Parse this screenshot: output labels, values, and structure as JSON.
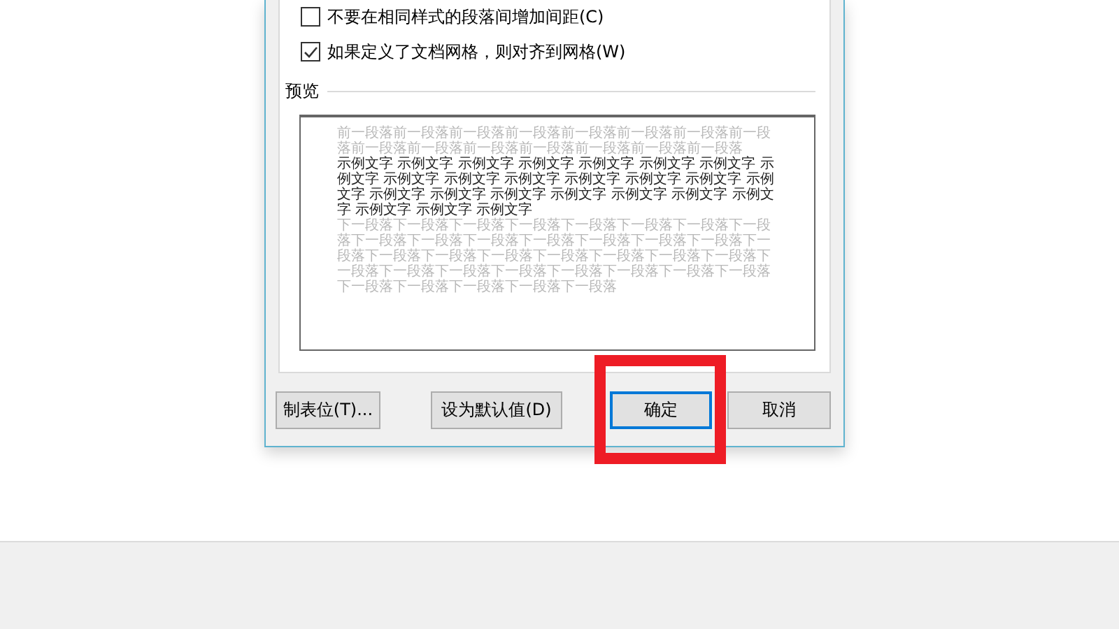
{
  "dialog": {
    "options": [
      {
        "label": "不要在相同样式的段落间增加间距(C)",
        "checked": false
      },
      {
        "label": "如果定义了文档网格，则对齐到网格(W)",
        "checked": true
      }
    ],
    "preview": {
      "label": "预览",
      "previous": "前一段落前一段落前一段落前一段落前一段落前一段落前一段落前一段落前一段落前一段落前一段落前一段落前一段落前一段落前一段落",
      "sample": "示例文字 示例文字 示例文字 示例文字 示例文字 示例文字 示例文字 示例文字 示例文字 示例文字 示例文字 示例文字 示例文字 示例文字 示例文字 示例文字 示例文字 示例文字 示例文字 示例文字 示例文字 示例文字 示例文字 示例文字 示例文字",
      "next": "下一段落下一段落下一段落下一段落下一段落下一段落下一段落下一段落下一段落下一段落下一段落下一段落下一段落下一段落下一段落下一段落下一段落下一段落下一段落下一段落下一段落下一段落下一段落下一段落下一段落下一段落下一段落下一段落下一段落下一段落下一段落下一段落下一段落下一段落下一段落下一段落"
    },
    "buttons": [
      {
        "label": "制表位(T)...",
        "default": false,
        "highlighted": false
      },
      {
        "label": "设为默认值(D)",
        "default": false,
        "highlighted": false
      },
      {
        "label": "确定",
        "default": true,
        "highlighted": true
      },
      {
        "label": "取消",
        "default": false,
        "highlighted": false
      }
    ]
  }
}
